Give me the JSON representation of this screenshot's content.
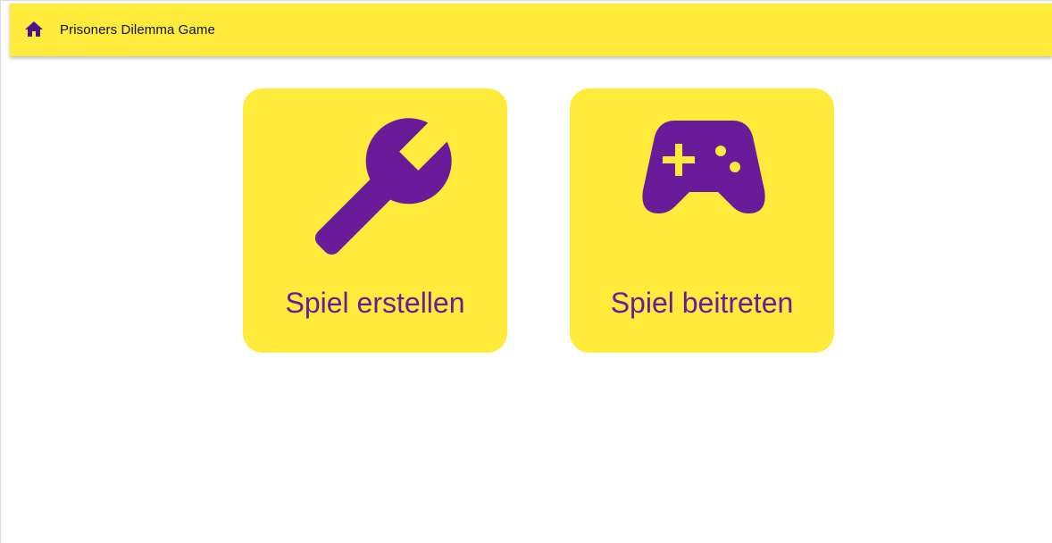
{
  "toolbar": {
    "title": "Prisoners Dilemma Game",
    "home_icon": "home-icon"
  },
  "cards": {
    "create": {
      "label": "Spiel erstellen",
      "icon": "wrench-icon"
    },
    "join": {
      "label": "Spiel beitreten",
      "icon": "gamepad-icon"
    }
  },
  "colors": {
    "accent_yellow": "#ffeb3b",
    "primary_purple": "#6a1b9a",
    "background": "#ffffff"
  }
}
